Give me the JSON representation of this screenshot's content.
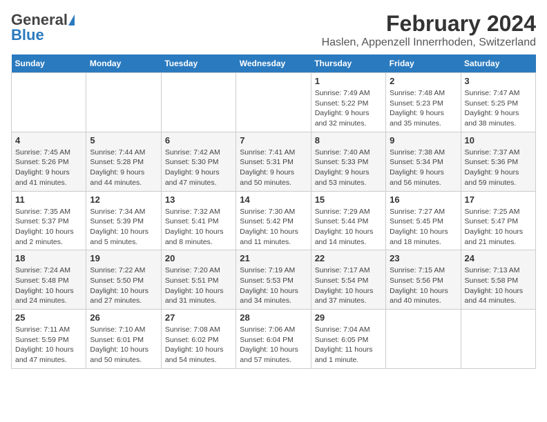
{
  "header": {
    "logo_general": "General",
    "logo_blue": "Blue",
    "title": "February 2024",
    "subtitle": "Haslen, Appenzell Innerrhoden, Switzerland"
  },
  "weekdays": [
    "Sunday",
    "Monday",
    "Tuesday",
    "Wednesday",
    "Thursday",
    "Friday",
    "Saturday"
  ],
  "weeks": [
    [
      {
        "day": "",
        "info": ""
      },
      {
        "day": "",
        "info": ""
      },
      {
        "day": "",
        "info": ""
      },
      {
        "day": "",
        "info": ""
      },
      {
        "day": "1",
        "info": "Sunrise: 7:49 AM\nSunset: 5:22 PM\nDaylight: 9 hours\nand 32 minutes."
      },
      {
        "day": "2",
        "info": "Sunrise: 7:48 AM\nSunset: 5:23 PM\nDaylight: 9 hours\nand 35 minutes."
      },
      {
        "day": "3",
        "info": "Sunrise: 7:47 AM\nSunset: 5:25 PM\nDaylight: 9 hours\nand 38 minutes."
      }
    ],
    [
      {
        "day": "4",
        "info": "Sunrise: 7:45 AM\nSunset: 5:26 PM\nDaylight: 9 hours\nand 41 minutes."
      },
      {
        "day": "5",
        "info": "Sunrise: 7:44 AM\nSunset: 5:28 PM\nDaylight: 9 hours\nand 44 minutes."
      },
      {
        "day": "6",
        "info": "Sunrise: 7:42 AM\nSunset: 5:30 PM\nDaylight: 9 hours\nand 47 minutes."
      },
      {
        "day": "7",
        "info": "Sunrise: 7:41 AM\nSunset: 5:31 PM\nDaylight: 9 hours\nand 50 minutes."
      },
      {
        "day": "8",
        "info": "Sunrise: 7:40 AM\nSunset: 5:33 PM\nDaylight: 9 hours\nand 53 minutes."
      },
      {
        "day": "9",
        "info": "Sunrise: 7:38 AM\nSunset: 5:34 PM\nDaylight: 9 hours\nand 56 minutes."
      },
      {
        "day": "10",
        "info": "Sunrise: 7:37 AM\nSunset: 5:36 PM\nDaylight: 9 hours\nand 59 minutes."
      }
    ],
    [
      {
        "day": "11",
        "info": "Sunrise: 7:35 AM\nSunset: 5:37 PM\nDaylight: 10 hours\nand 2 minutes."
      },
      {
        "day": "12",
        "info": "Sunrise: 7:34 AM\nSunset: 5:39 PM\nDaylight: 10 hours\nand 5 minutes."
      },
      {
        "day": "13",
        "info": "Sunrise: 7:32 AM\nSunset: 5:41 PM\nDaylight: 10 hours\nand 8 minutes."
      },
      {
        "day": "14",
        "info": "Sunrise: 7:30 AM\nSunset: 5:42 PM\nDaylight: 10 hours\nand 11 minutes."
      },
      {
        "day": "15",
        "info": "Sunrise: 7:29 AM\nSunset: 5:44 PM\nDaylight: 10 hours\nand 14 minutes."
      },
      {
        "day": "16",
        "info": "Sunrise: 7:27 AM\nSunset: 5:45 PM\nDaylight: 10 hours\nand 18 minutes."
      },
      {
        "day": "17",
        "info": "Sunrise: 7:25 AM\nSunset: 5:47 PM\nDaylight: 10 hours\nand 21 minutes."
      }
    ],
    [
      {
        "day": "18",
        "info": "Sunrise: 7:24 AM\nSunset: 5:48 PM\nDaylight: 10 hours\nand 24 minutes."
      },
      {
        "day": "19",
        "info": "Sunrise: 7:22 AM\nSunset: 5:50 PM\nDaylight: 10 hours\nand 27 minutes."
      },
      {
        "day": "20",
        "info": "Sunrise: 7:20 AM\nSunset: 5:51 PM\nDaylight: 10 hours\nand 31 minutes."
      },
      {
        "day": "21",
        "info": "Sunrise: 7:19 AM\nSunset: 5:53 PM\nDaylight: 10 hours\nand 34 minutes."
      },
      {
        "day": "22",
        "info": "Sunrise: 7:17 AM\nSunset: 5:54 PM\nDaylight: 10 hours\nand 37 minutes."
      },
      {
        "day": "23",
        "info": "Sunrise: 7:15 AM\nSunset: 5:56 PM\nDaylight: 10 hours\nand 40 minutes."
      },
      {
        "day": "24",
        "info": "Sunrise: 7:13 AM\nSunset: 5:58 PM\nDaylight: 10 hours\nand 44 minutes."
      }
    ],
    [
      {
        "day": "25",
        "info": "Sunrise: 7:11 AM\nSunset: 5:59 PM\nDaylight: 10 hours\nand 47 minutes."
      },
      {
        "day": "26",
        "info": "Sunrise: 7:10 AM\nSunset: 6:01 PM\nDaylight: 10 hours\nand 50 minutes."
      },
      {
        "day": "27",
        "info": "Sunrise: 7:08 AM\nSunset: 6:02 PM\nDaylight: 10 hours\nand 54 minutes."
      },
      {
        "day": "28",
        "info": "Sunrise: 7:06 AM\nSunset: 6:04 PM\nDaylight: 10 hours\nand 57 minutes."
      },
      {
        "day": "29",
        "info": "Sunrise: 7:04 AM\nSunset: 6:05 PM\nDaylight: 11 hours\nand 1 minute."
      },
      {
        "day": "",
        "info": ""
      },
      {
        "day": "",
        "info": ""
      }
    ]
  ]
}
